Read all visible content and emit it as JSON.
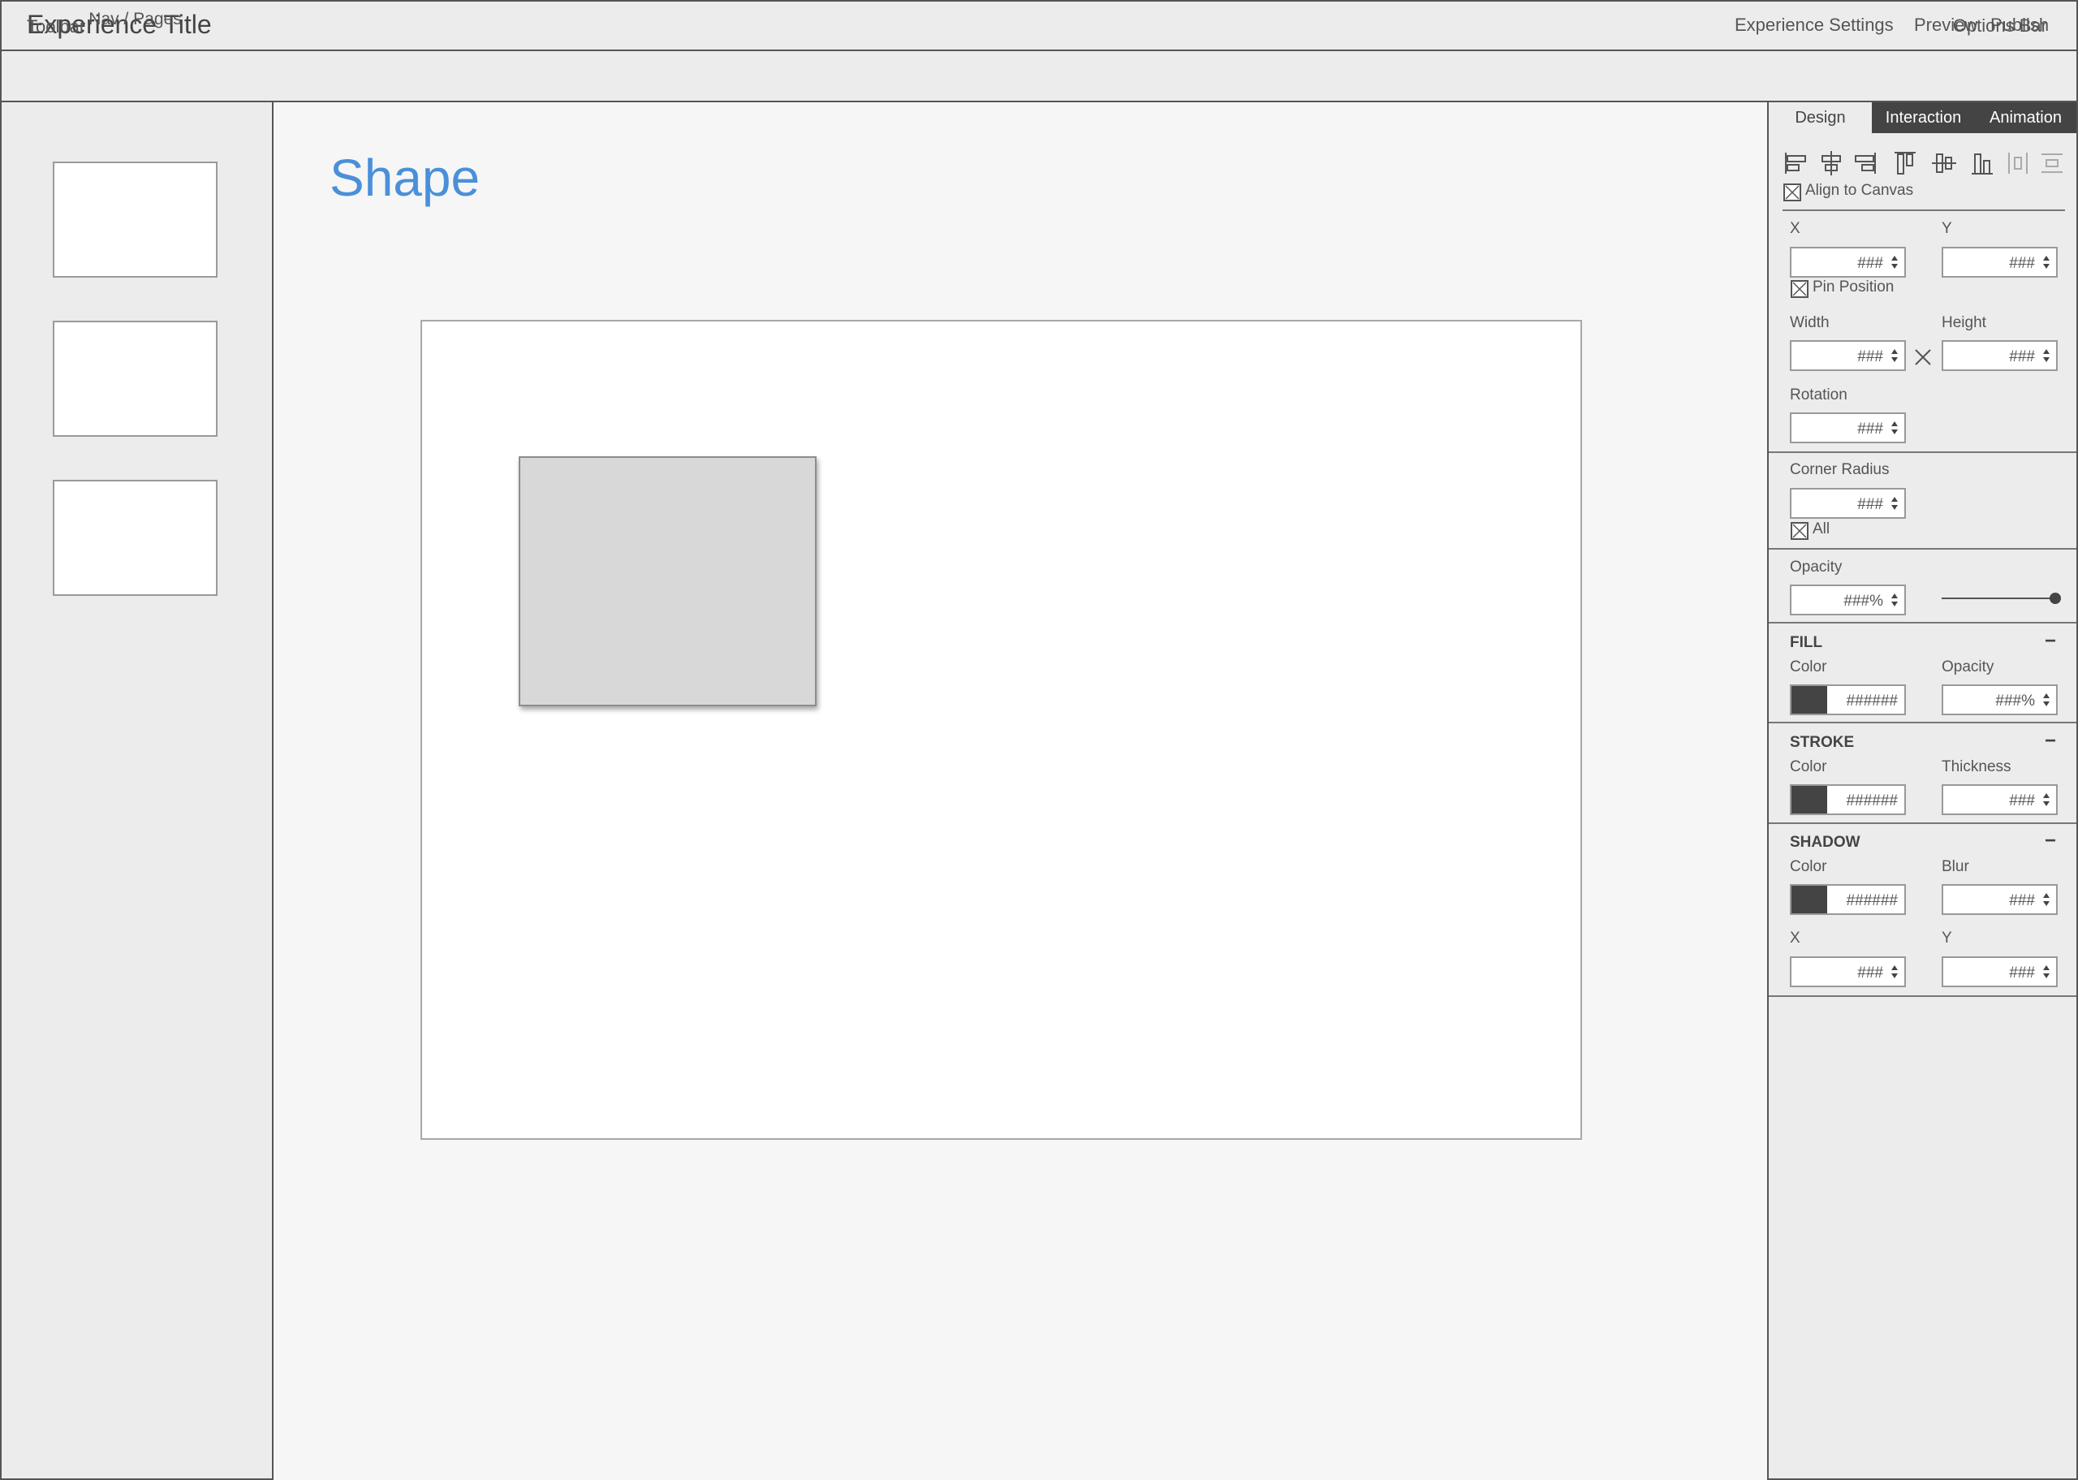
{
  "header": {
    "title": "Experience Title",
    "settings_label": "Experience Settings",
    "preview_label": "Preview",
    "publish_label": "Publish"
  },
  "toolbar": {
    "label": "Toolbar",
    "options_label": "Options Bar"
  },
  "nav": {
    "label": "Nav / Pages",
    "pages": 3
  },
  "canvas": {
    "heading": "Shape",
    "heading_color": "#4a90d9"
  },
  "inspector": {
    "tabs": [
      "Design",
      "Interaction",
      "Animation"
    ],
    "active_tab": "Design",
    "align_icons": [
      "align-left-icon",
      "align-center-horizontal-icon",
      "align-right-icon",
      "align-top-icon",
      "align-middle-vertical-icon",
      "align-bottom-icon",
      "distribute-horizontal-icon",
      "distribute-vertical-icon"
    ],
    "align_to_canvas": "Align to Canvas",
    "x_label": "X",
    "y_label": "Y",
    "x_value": "###",
    "y_value": "###",
    "pin_position": "Pin Position",
    "width_label": "Width",
    "height_label": "Height",
    "width_value": "###",
    "height_value": "###",
    "rotation_label": "Rotation",
    "rotation_value": "###",
    "corner_radius_label": "Corner Radius",
    "corner_radius_value": "###",
    "all_label": "All",
    "opacity_label": "Opacity",
    "opacity_value": "###%",
    "fill": {
      "title": "FILL",
      "color_label": "Color",
      "color_value": "######",
      "opacity_label": "Opacity",
      "opacity_value": "###%"
    },
    "stroke": {
      "title": "STROKE",
      "color_label": "Color",
      "color_value": "######",
      "thickness_label": "Thickness",
      "thickness_value": "###"
    },
    "shadow": {
      "title": "SHADOW",
      "color_label": "Color",
      "color_value": "######",
      "blur_label": "Blur",
      "blur_value": "###",
      "x_label": "X",
      "y_label": "Y",
      "x_value": "###",
      "y_value": "###"
    },
    "collapse_symbol": "−",
    "swatch_color": "#444444"
  }
}
